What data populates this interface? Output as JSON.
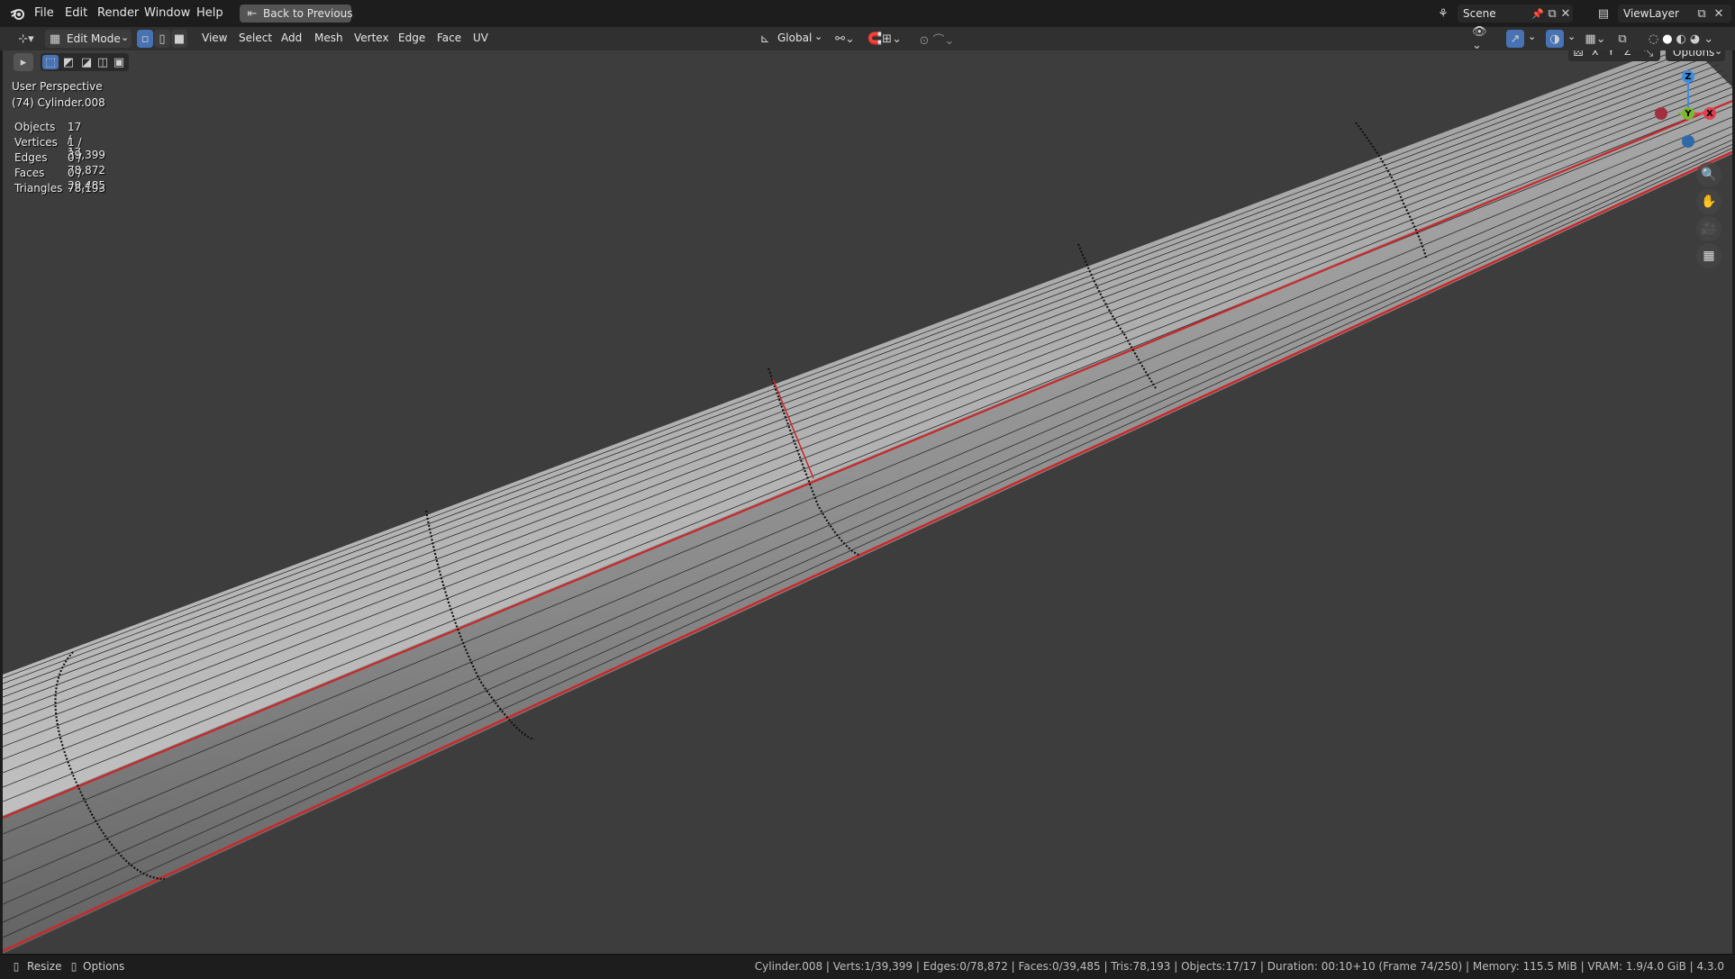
{
  "menu": {
    "file": "File",
    "edit": "Edit",
    "render": "Render",
    "window": "Window",
    "help": "Help",
    "back_to_previous": "Back to Previous"
  },
  "header_right": {
    "scene": "Scene",
    "view_layer": "ViewLayer"
  },
  "toolbar": {
    "mode": "Edit Mode",
    "view": "View",
    "select": "Select",
    "add": "Add",
    "mesh": "Mesh",
    "vertex": "Vertex",
    "edge": "Edge",
    "face": "Face",
    "uv": "UV",
    "orientation": "Global",
    "options": "Options",
    "axis_x": "X",
    "axis_y": "Y",
    "axis_z": "Z"
  },
  "viewport_info": {
    "perspective": "User Perspective",
    "object": "(74) Cylinder.008",
    "stats": [
      {
        "label": "Objects",
        "value": "17 / 17"
      },
      {
        "label": "Vertices",
        "value": "1 / 39,399"
      },
      {
        "label": "Edges",
        "value": "0 / 78,872"
      },
      {
        "label": "Faces",
        "value": "0 / 39,485"
      },
      {
        "label": "Triangles",
        "value": "78,193"
      }
    ]
  },
  "gizmo": {
    "x": "X",
    "y": "Y",
    "z": "Z"
  },
  "statusbar": {
    "resize": "Resize",
    "options": "Options",
    "info": "Cylinder.008 | Verts:1/39,399 | Edges:0/78,872 | Faces:0/39,485 | Tris:78,193 | Objects:17/17 | Duration: 00:10+10 (Frame 74/250) | Memory: 115.5 MiB | VRAM: 1.9/4.0 GiB | 4.3.0"
  },
  "colors": {
    "viewport_bg": "#3d3d3d",
    "mesh_light": "#b8b8b8",
    "mesh_dark": "#6e6e6e",
    "seam_red": "#c8282a",
    "gizmo_x": "#e04050",
    "gizmo_y": "#7cb82e",
    "gizmo_z": "#3b8de0"
  },
  "icons": [
    "blender-logo-icon",
    "back-icon",
    "editor-type-icon",
    "mode-icon",
    "vertex-select-icon",
    "edge-select-icon",
    "face-select-icon",
    "transform-orientation-icon",
    "pivot-icon",
    "snap-icon",
    "proportional-icon",
    "overlay-icon",
    "xray-icon",
    "shading-icon",
    "zoom-icon",
    "hand-icon",
    "camera-icon",
    "grid-icon"
  ]
}
